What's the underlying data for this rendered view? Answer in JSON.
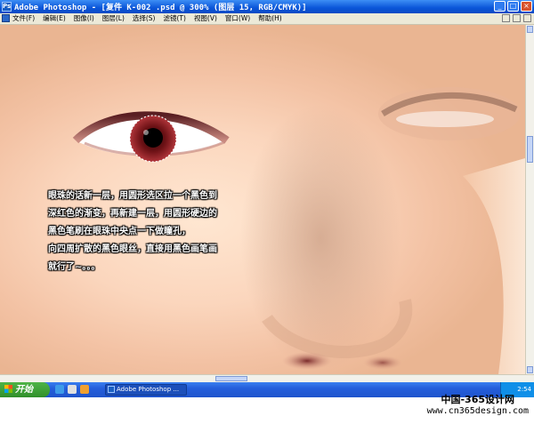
{
  "window": {
    "title": "Adobe Photoshop - [复件 K-002 .psd @ 300% (图层 15, RGB/CMYK)]",
    "controls": {
      "minimize": "_",
      "maximize": "□",
      "close": "×"
    }
  },
  "menu": {
    "items": [
      "文件(F)",
      "编辑(E)",
      "图像(I)",
      "图层(L)",
      "选择(S)",
      "滤镜(T)",
      "视图(V)",
      "窗口(W)",
      "帮助(H)"
    ]
  },
  "canvas": {
    "caption_lines": [
      "眼珠的话新一层，用圆形选区拉一个黑色到",
      "深红色的渐变，再新建一层，用圆形硬边的",
      "黑色笔刷在眼珠中央点一下做瞳孔，",
      "向四周扩散的黑色眼丝，直接用黑色画笔画",
      "就行了~。。。"
    ],
    "colors": {
      "skin": "#fbd6bd",
      "iris": "#7a1418",
      "pupil": "#000000"
    }
  },
  "taskbar": {
    "start_label": "开始",
    "task_label": "Adobe Photoshop ...",
    "clock": "2:54"
  },
  "watermark": {
    "line1": "中国-365设计网",
    "line2": "www.cn365design.com"
  }
}
